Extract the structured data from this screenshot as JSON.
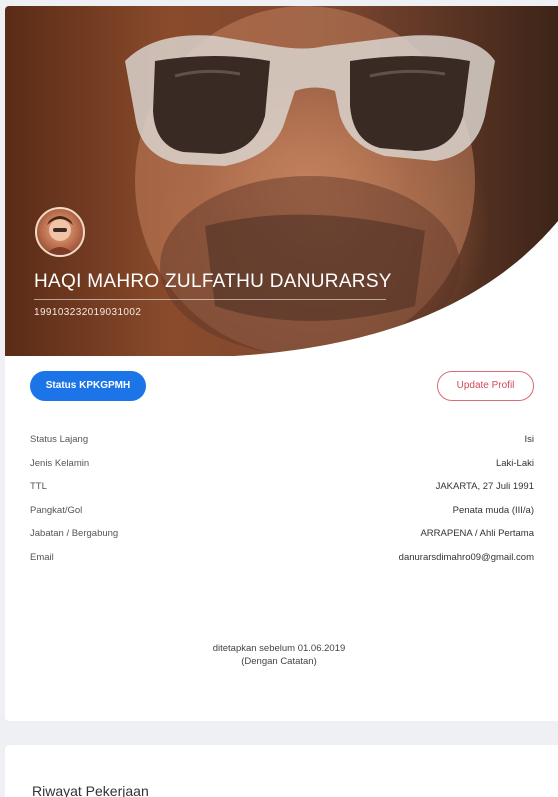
{
  "profile": {
    "name": "HAQI MAHRO ZULFATHU DANURARSY",
    "id_number": "199103232019031002"
  },
  "buttons": {
    "status_label": "Status KPKGPMH",
    "update_label": "Update Profil"
  },
  "details": [
    {
      "label": "Status Lajang",
      "value": "Isi"
    },
    {
      "label": "Jenis Kelamin",
      "value": "Laki-Laki"
    },
    {
      "label": "TTL",
      "value": "JAKARTA, 27 Juli 1991"
    },
    {
      "label": "Pangkat/Gol",
      "value": "Penata muda (III/a)"
    },
    {
      "label": "Jabatan / Bergabung",
      "value": "ARRAPENA / Ahli Pertama"
    },
    {
      "label": "Email",
      "value": "danurarsdimahro09@gmail.com"
    }
  ],
  "note": {
    "line1": "ditetapkan sebelum 01.06.2019",
    "line2": "(Dengan Catatan)"
  },
  "section2": {
    "title": "Riwayat Pekerjaan"
  },
  "colors": {
    "primary_button": "#1b75e8",
    "update_button_border": "#d96a77",
    "page_background": "#eef0f4"
  }
}
